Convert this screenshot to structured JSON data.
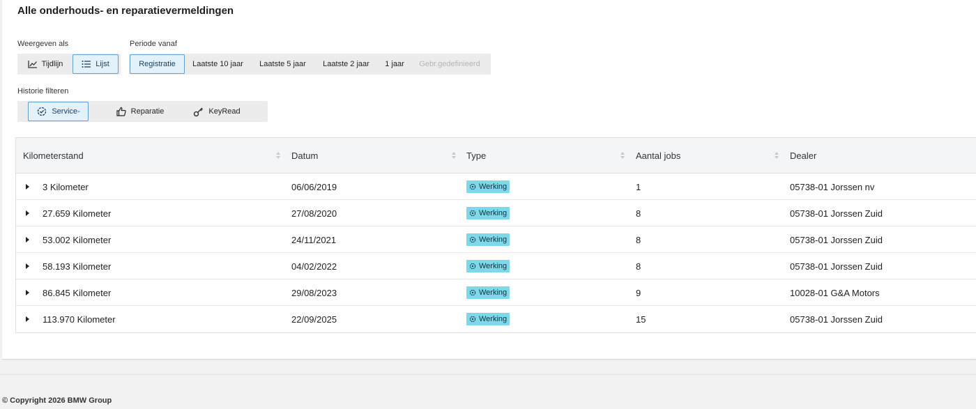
{
  "page_title": "Alle onderhouds- en reparatievermeldingen",
  "view": {
    "label": "Weergeven als",
    "options": [
      {
        "label": "Tijdlijn",
        "icon": "line-chart-icon",
        "active": false
      },
      {
        "label": "Lijst",
        "icon": "list-icon",
        "active": true
      }
    ]
  },
  "period": {
    "label": "Periode vanaf",
    "options": [
      {
        "label": "Registratie",
        "active": true,
        "disabled": false
      },
      {
        "label": "Laatste 10 jaar",
        "active": false,
        "disabled": false
      },
      {
        "label": "Laatste 5 jaar",
        "active": false,
        "disabled": false
      },
      {
        "label": "Laatste 2 jaar",
        "active": false,
        "disabled": false
      },
      {
        "label": "1 jaar",
        "active": false,
        "disabled": false
      },
      {
        "label": "Gebr.gedefinieerd",
        "active": false,
        "disabled": true
      }
    ]
  },
  "filter": {
    "label": "Historie filteren",
    "options": [
      {
        "label": "Service-",
        "icon": "service-gear-icon",
        "active": true
      },
      {
        "label": "Reparatie",
        "icon": "thumbs-up-icon",
        "active": false
      },
      {
        "label": "KeyRead",
        "icon": "key-icon",
        "active": false
      }
    ]
  },
  "table": {
    "columns": [
      "Kilometerstand",
      "Datum",
      "Type",
      "Aantal jobs",
      "Dealer"
    ],
    "rows": [
      {
        "km": "3 Kilometer",
        "date": "06/06/2019",
        "type": "Werking",
        "jobs": "1",
        "dealer": "05738-01 Jorssen nv"
      },
      {
        "km": "27.659 Kilometer",
        "date": "27/08/2020",
        "type": "Werking",
        "jobs": "8",
        "dealer": "05738-01 Jorssen Zuid"
      },
      {
        "km": "53.002 Kilometer",
        "date": "24/11/2021",
        "type": "Werking",
        "jobs": "8",
        "dealer": "05738-01 Jorssen Zuid"
      },
      {
        "km": "58.193 Kilometer",
        "date": "04/02/2022",
        "type": "Werking",
        "jobs": "8",
        "dealer": "05738-01 Jorssen Zuid"
      },
      {
        "km": "86.845 Kilometer",
        "date": "29/08/2023",
        "type": "Werking",
        "jobs": "9",
        "dealer": "10028-01 G&A Motors"
      },
      {
        "km": "113.970 Kilometer",
        "date": "22/09/2025",
        "type": "Werking",
        "jobs": "15",
        "dealer": "05738-01 Jorssen Zuid"
      }
    ]
  },
  "colors": {
    "accent": "#5f9fd1",
    "badge": "#7fd8ea"
  },
  "footer": {
    "copyright": "© Copyright 2026 BMW Group"
  }
}
